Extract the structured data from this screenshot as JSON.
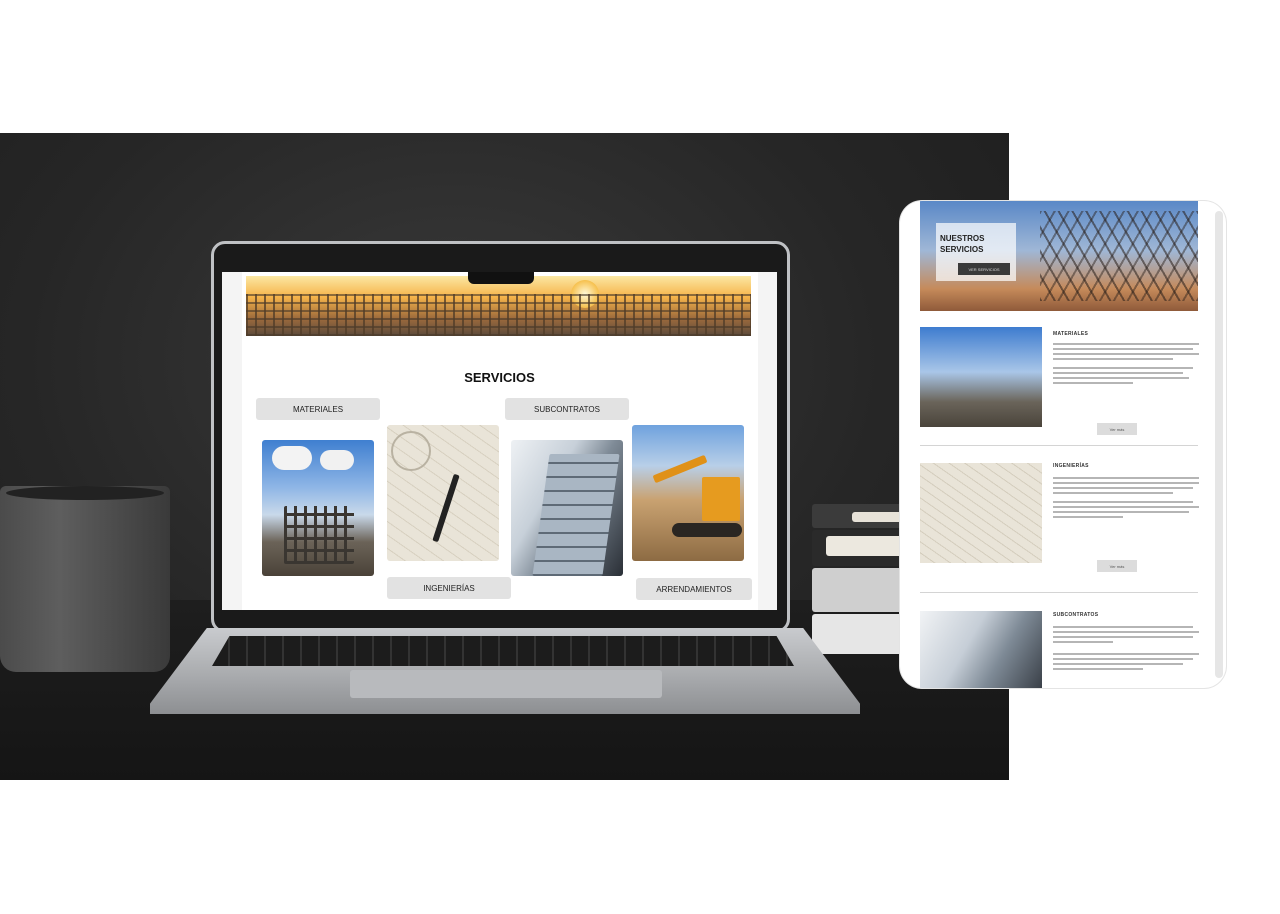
{
  "desktop_site": {
    "title": "SERVICIOS",
    "services": [
      {
        "label": "MATERIALES",
        "image": "construction-crane-photo"
      },
      {
        "label": "INGENIERÍAS",
        "image": "blueprint-drawing-photo"
      },
      {
        "label": "SUBCONTRATOS",
        "image": "glass-building-photo"
      },
      {
        "label": "ARRENDAMIENTOS",
        "image": "excavator-photo"
      }
    ]
  },
  "mobile_site": {
    "hero_title": "NUESTROS SERVICIOS",
    "hero_button": "VER SERVICIOS",
    "sections": [
      {
        "heading": "MATERIALES",
        "button": "Ver más"
      },
      {
        "heading": "INGENIERÍAS",
        "button": "Ver más"
      },
      {
        "heading": "SUBCONTRATOS",
        "button": ""
      }
    ]
  },
  "colors": {
    "button_bg": "#e2e2e2",
    "backdrop": "#262626",
    "laptop_frame": "#bfc1c4"
  }
}
